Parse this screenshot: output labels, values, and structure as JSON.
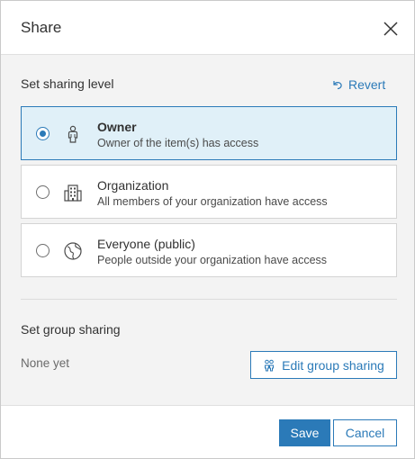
{
  "dialog": {
    "title": "Share",
    "close_icon": "close-icon"
  },
  "sharing_level": {
    "label": "Set sharing level",
    "revert_label": "Revert",
    "options": [
      {
        "title": "Owner",
        "description": "Owner of the item(s) has access",
        "icon": "person-icon",
        "selected": true
      },
      {
        "title": "Organization",
        "description": "All members of your organization have access",
        "icon": "building-icon",
        "selected": false
      },
      {
        "title": "Everyone (public)",
        "description": "People outside your organization have access",
        "icon": "globe-icon",
        "selected": false
      }
    ]
  },
  "group_sharing": {
    "label": "Set group sharing",
    "status": "None yet",
    "edit_label": "Edit group sharing"
  },
  "footer": {
    "save_label": "Save",
    "cancel_label": "Cancel"
  },
  "colors": {
    "accent": "#2b7ab8",
    "selected_bg": "#e0f0f8",
    "panel_bg": "#f3f3f3"
  }
}
